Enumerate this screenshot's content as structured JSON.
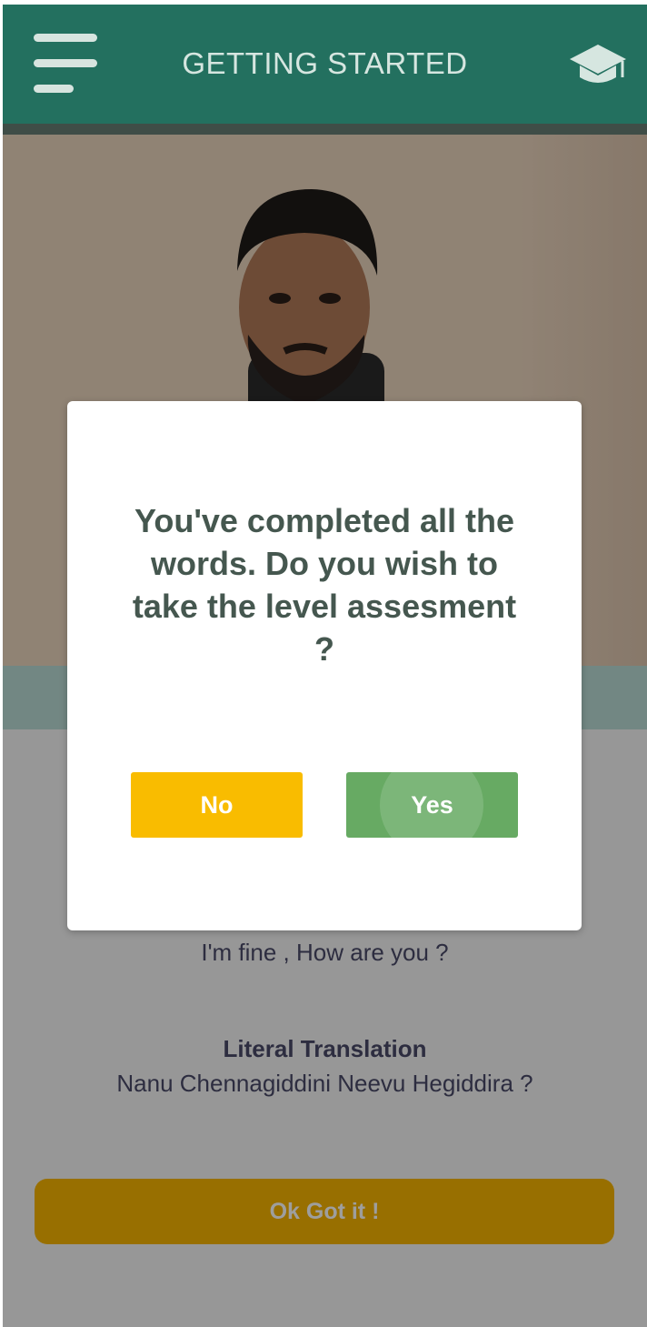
{
  "header": {
    "title": "GETTING STARTED",
    "menu_icon": "hamburger-menu-icon",
    "right_icon": "graduation-cap-icon"
  },
  "lesson": {
    "translation": "I'm fine , How are you ?",
    "literal_title": "Literal Translation",
    "literal_text": "Nanu Chennagiddini Neevu Hegiddira ?",
    "ok_button": "Ok Got it !"
  },
  "dialog": {
    "message": "You've completed all the words. Do you wish to take the level assesment ?",
    "no_label": "No",
    "yes_label": "Yes"
  },
  "colors": {
    "header": "#23705f",
    "no_button": "#f9bc00",
    "yes_button": "#67aa63",
    "ok_button": "#f6b400"
  }
}
